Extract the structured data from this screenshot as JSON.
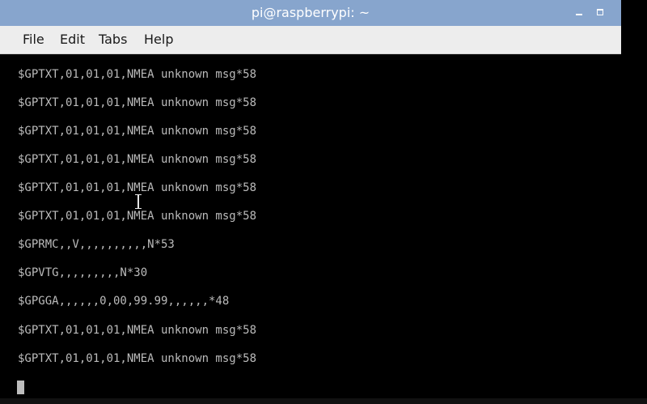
{
  "window": {
    "title": "pi@raspberrypi: ~"
  },
  "menubar": {
    "items": [
      {
        "label": "File"
      },
      {
        "label": "Edit"
      },
      {
        "label": "Tabs"
      },
      {
        "label": "Help"
      }
    ]
  },
  "terminal": {
    "lines": [
      "$GPTXT,01,01,01,NMEA unknown msg*58",
      "$GPTXT,01,01,01,NMEA unknown msg*58",
      "$GPTXT,01,01,01,NMEA unknown msg*58",
      "$GPTXT,01,01,01,NMEA unknown msg*58",
      "$GPTXT,01,01,01,NMEA unknown msg*58",
      "$GPTXT,01,01,01,NMEA unknown msg*58",
      "$GPRMC,,V,,,,,,,,,,N*53",
      "$GPVTG,,,,,,,,,N*30",
      "$GPGGA,,,,,,0,00,99.99,,,,,,*48",
      "$GPTXT,01,01,01,NMEA unknown msg*58",
      "$GPTXT,01,01,01,NMEA unknown msg*58"
    ]
  },
  "colors": {
    "titlebar": "#87a5cd",
    "menubar": "#ededed",
    "terminal_bg": "#000000",
    "terminal_fg": "#bbbbbb"
  },
  "icons": {
    "minimize": "minimize-icon",
    "maximize": "maximize-icon",
    "cursor": "text-cursor-icon"
  }
}
